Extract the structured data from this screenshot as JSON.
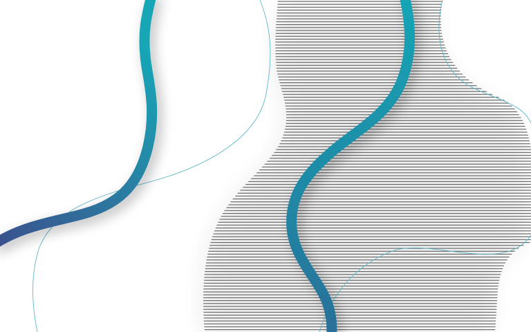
{
  "artwork": {
    "kind": "abstract decorative background",
    "colors": {
      "background": "#ffffff",
      "stripe": "#3a3a3a",
      "thin_line": "#5bb8c9",
      "curve_gradient_start": "#3b4f8c",
      "curve_gradient_mid": "#2a7fa3",
      "curve_gradient_end": "#16a6b6",
      "shadow": "#000000"
    },
    "elements": [
      "striped-wave-band",
      "thick-gradient-curve-left",
      "thick-gradient-curve-right",
      "thin-line-curves"
    ]
  }
}
